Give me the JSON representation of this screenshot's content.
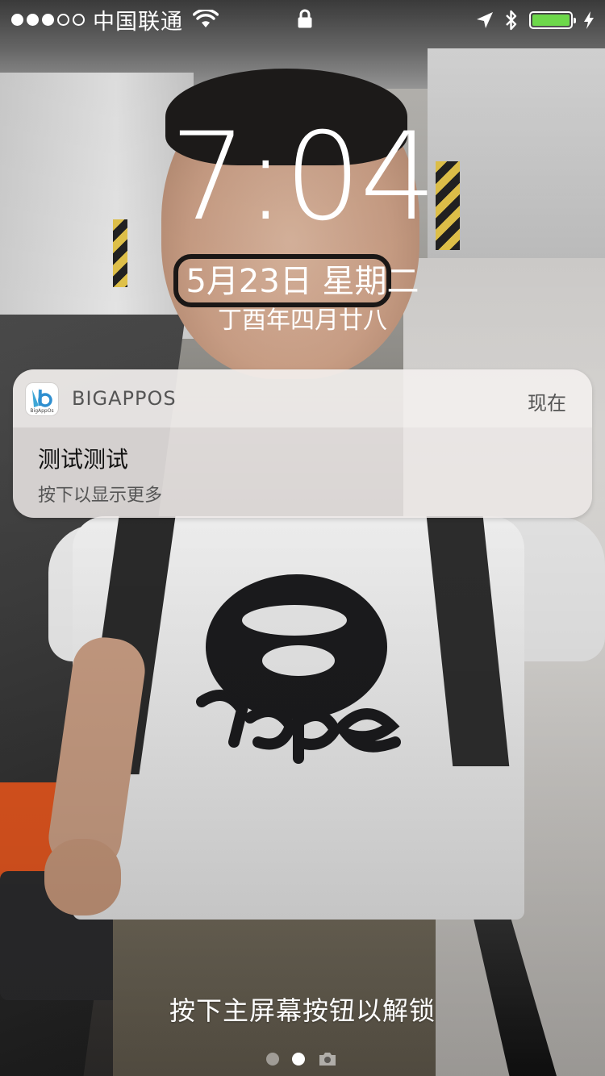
{
  "status_bar": {
    "signal_dots_filled": 3,
    "signal_dots_total": 5,
    "carrier": "中国联通",
    "icons": [
      "wifi-icon",
      "lock-icon",
      "location-arrow-icon",
      "bluetooth-icon",
      "battery-icon",
      "charging-icon"
    ],
    "battery_level": 1.0,
    "battery_color": "#6dd84a"
  },
  "lockscreen": {
    "time": "7:04",
    "date": "5月23日 星期二",
    "lunar_date": "丁酉年四月廿八"
  },
  "notification": {
    "app_name": "BIGAPPOS",
    "app_icon_caption": "BigAppOs",
    "time": "现在",
    "title": "测试测试",
    "subtitle": "按下以显示更多"
  },
  "bottom": {
    "unlock_hint": "按下主屏幕按钮以解锁",
    "page_count": 2,
    "active_page": 2
  }
}
